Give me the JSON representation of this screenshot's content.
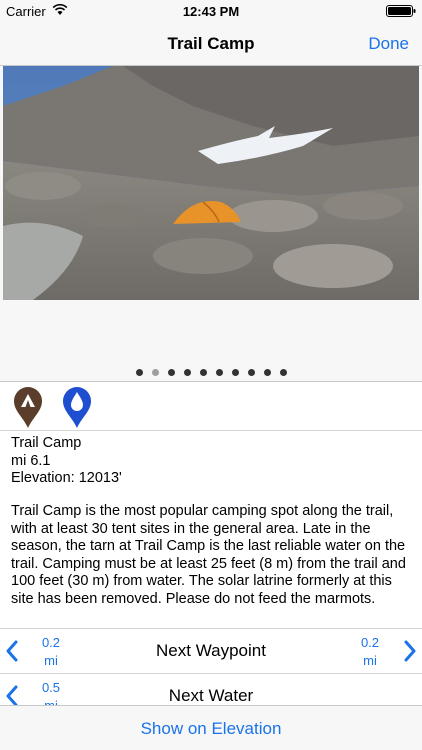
{
  "status_bar": {
    "carrier": "Carrier",
    "time": "12:43 PM"
  },
  "nav": {
    "title": "Trail Camp",
    "done_label": "Done"
  },
  "gallery": {
    "page_count": 10,
    "current_page": 2
  },
  "markers": [
    {
      "icon": "campsite-marker-icon",
      "color": "#5a3d2b"
    },
    {
      "icon": "water-marker-icon",
      "color": "#1f4fd1"
    }
  ],
  "info": {
    "name": "Trail Camp",
    "mile": "mi 6.1",
    "elevation": "Elevation: 12013'"
  },
  "description": "Trail Camp is the most popular camping spot along the trail, with at least 30 tent sites in the general area. Late in the season, the tarn at Trail Camp is the last reliable water on the trail. Camping must be at least 25 feet (8 m) from the trail and 100 feet (30 m) from water.  The solar latrine formerly at this site has been removed.  Please do not feed the marmots.",
  "next_waypoint": {
    "label": "Next Waypoint",
    "prev_dist": "0.2",
    "prev_unit": "mi",
    "next_dist": "0.2",
    "next_unit": "mi"
  },
  "next_water": {
    "label": "Next Water",
    "prev_dist": "0.5",
    "prev_unit": "mi"
  },
  "bottom": {
    "button_label": "Show on Elevation"
  },
  "colors": {
    "accent": "#1a73e8",
    "bar_bg": "#f7f7f7"
  }
}
